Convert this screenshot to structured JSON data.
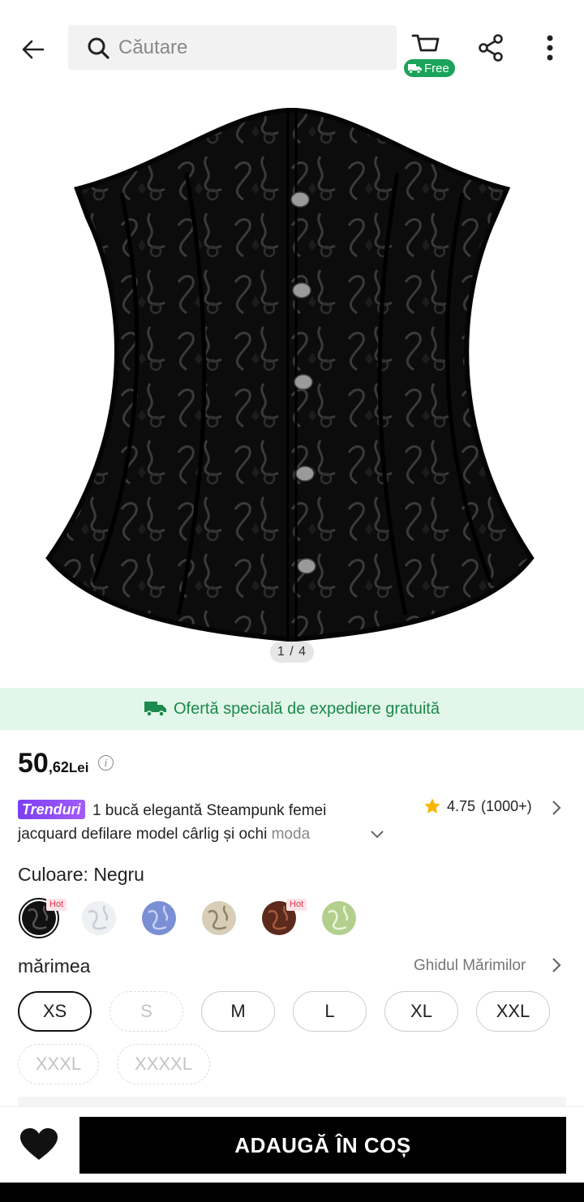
{
  "header": {
    "search_placeholder": "Căutare",
    "free_badge": "Free"
  },
  "gallery": {
    "counter": "1 / 4"
  },
  "shipping_banner": {
    "text": "Ofertă specială de expediere gratuită",
    "color": "#1b8a4a"
  },
  "price": {
    "integer": "50",
    "decimal": ",62",
    "currency": "Lei"
  },
  "product": {
    "badge": "Trenduri",
    "title_main": " 1 bucă elegantă Steampunk femei jacquard defilare model cârlig și ochi ",
    "title_fade": "moda",
    "rating": "4.75",
    "rating_count": "(1000+)"
  },
  "color": {
    "label": "Culoare: Negru",
    "swatches": [
      {
        "name": "black",
        "hot": "Hot",
        "selected": true
      },
      {
        "name": "white",
        "hot": ""
      },
      {
        "name": "blue",
        "hot": ""
      },
      {
        "name": "beige",
        "hot": ""
      },
      {
        "name": "brown",
        "hot": "Hot"
      },
      {
        "name": "green",
        "hot": ""
      }
    ]
  },
  "size": {
    "label": "mărimea",
    "guide": "Ghidul Mărimilor",
    "options": [
      "XS",
      "S",
      "M",
      "L",
      "XL",
      "XXL",
      "XXXL",
      "XXXXL"
    ],
    "selected": "XS",
    "unavailable": [
      "S",
      "XXXL",
      "XXXXL"
    ]
  },
  "bottom": {
    "add_to_cart": "ADAUGĂ ÎN COȘ"
  }
}
